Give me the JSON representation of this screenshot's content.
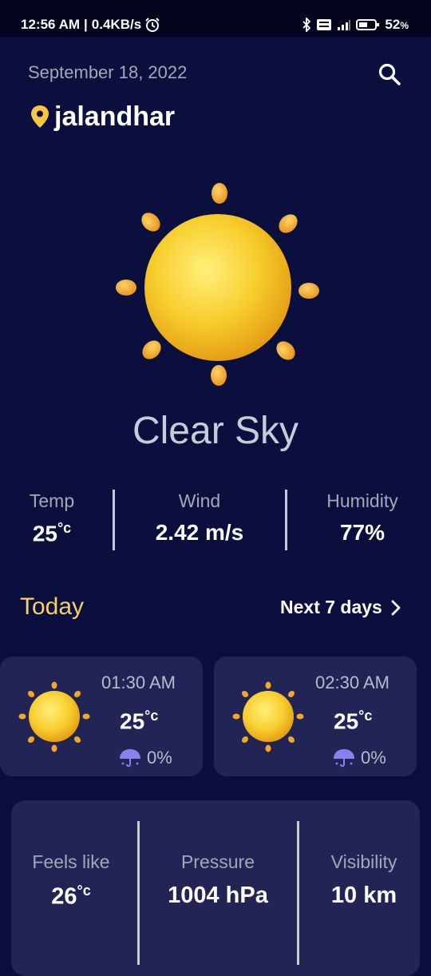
{
  "status_bar": {
    "time": "12:56 AM",
    "separator": "|",
    "speed": "0.4KB/s",
    "battery": "52",
    "battery_unit": "%"
  },
  "header": {
    "date": "September 18, 2022",
    "location": "jalandhar"
  },
  "current": {
    "condition": "Clear Sky",
    "stats": [
      {
        "label": "Temp",
        "value": "25",
        "unit": "°c"
      },
      {
        "label": "Wind",
        "value": "2.42 m/s",
        "unit": ""
      },
      {
        "label": "Humidity",
        "value": "77%",
        "unit": ""
      }
    ]
  },
  "forecast": {
    "today_label": "Today",
    "next_label": "Next 7 days",
    "hours": [
      {
        "time": "01:30 AM",
        "temp": "25",
        "unit": "°c",
        "rain": "0%"
      },
      {
        "time": "02:30 AM",
        "temp": "25",
        "unit": "°c",
        "rain": "0%"
      }
    ]
  },
  "details": [
    {
      "label": "Feels like",
      "value": "26",
      "unit": "°c"
    },
    {
      "label": "Pressure",
      "value": "1004 hPa",
      "unit": ""
    },
    {
      "label": "Visibility",
      "value": "10 km",
      "unit": ""
    }
  ],
  "colors": {
    "background": "#0b0f3e",
    "card": "#222455",
    "accent_today": "#f6cf68",
    "location_pin": "#f6c543",
    "umbrella": "#8c7ff0"
  },
  "icons": {
    "location": "location-pin-icon",
    "search": "search-icon",
    "weather": "sun-icon",
    "rain": "umbrella-icon",
    "next": "chevron-right-icon"
  }
}
